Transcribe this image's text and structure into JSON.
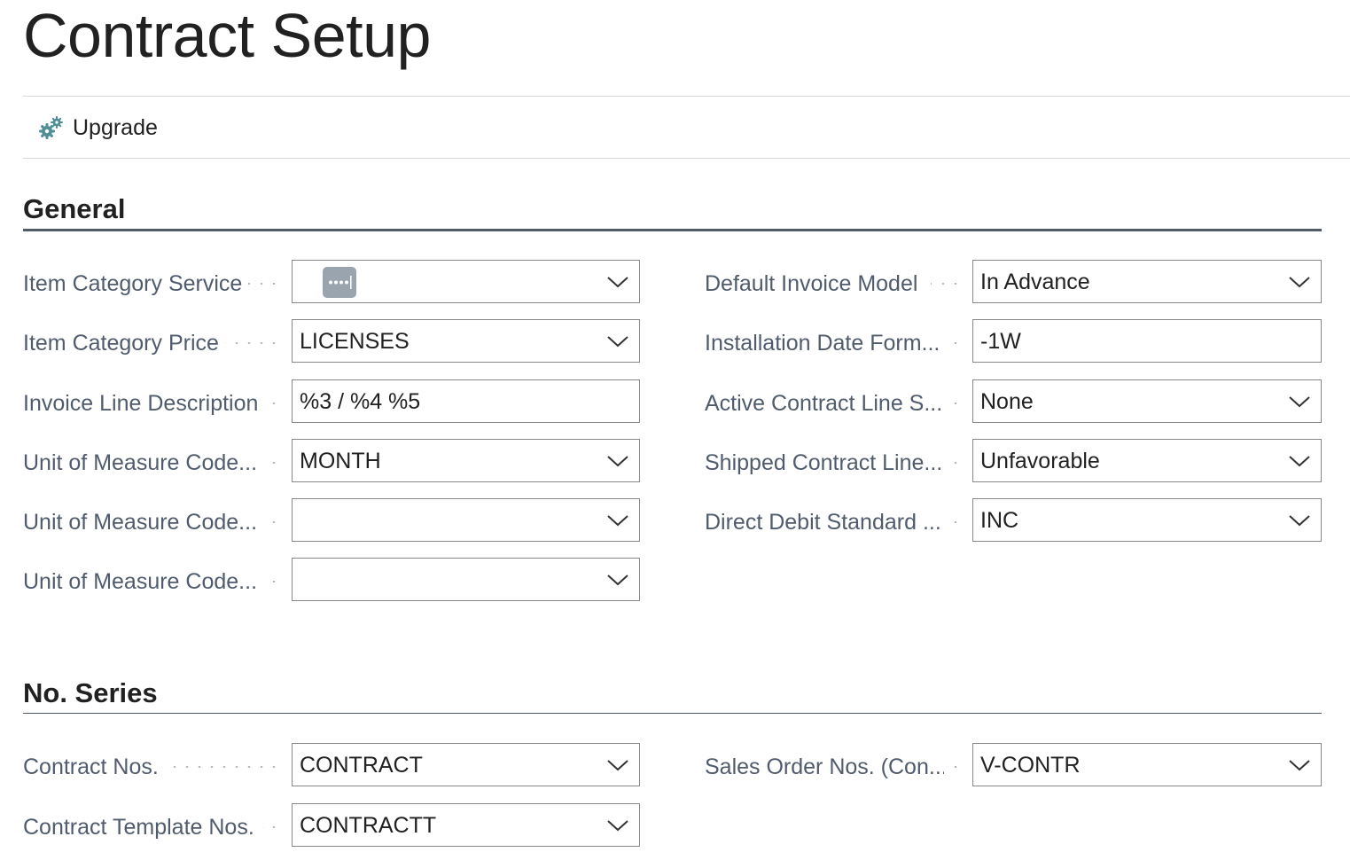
{
  "page": {
    "title": "Contract Setup"
  },
  "actions": {
    "upgrade_label": "Upgrade",
    "upgrade_icon": "gears-icon"
  },
  "general": {
    "title": "General",
    "left_fields": [
      {
        "label": "Item Category Service",
        "value": "",
        "type": "dropdown",
        "has_ellipsis_button": true
      },
      {
        "label": "Item Category Price",
        "value": "LICENSES",
        "type": "dropdown"
      },
      {
        "label": "Invoice Line Description",
        "value": "%3 / %4 %5",
        "type": "text"
      },
      {
        "label": "Unit of Measure Code...",
        "value": "MONTH",
        "type": "dropdown"
      },
      {
        "label": "Unit of Measure Code...",
        "value": "",
        "type": "dropdown"
      },
      {
        "label": "Unit of Measure Code...",
        "value": "",
        "type": "dropdown"
      }
    ],
    "right_fields": [
      {
        "label": "Default Invoice Model",
        "value": "In Advance",
        "type": "dropdown"
      },
      {
        "label": "Installation Date Form...",
        "value": "-1W",
        "type": "text"
      },
      {
        "label": "Active Contract Line S...",
        "value": "None",
        "type": "dropdown"
      },
      {
        "label": "Shipped Contract Line...",
        "value": "Unfavorable",
        "type": "dropdown"
      },
      {
        "label": "Direct Debit Standard ...",
        "value": "INC",
        "type": "dropdown"
      }
    ]
  },
  "no_series": {
    "title": "No. Series",
    "left_fields": [
      {
        "label": "Contract Nos.",
        "value": "CONTRACT",
        "type": "dropdown"
      },
      {
        "label": "Contract Template Nos.",
        "value": "CONTRACTT",
        "type": "dropdown"
      }
    ],
    "right_fields": [
      {
        "label": "Sales Order Nos. (Con...",
        "value": "V-CONTR",
        "type": "dropdown"
      }
    ]
  },
  "colors": {
    "label": "#505c6d",
    "text": "#212121",
    "border": "#8a8886",
    "section_rule": "#505c65",
    "gear_teal": "#4f8f95",
    "ellipsis_button": "#9aa4ae"
  }
}
